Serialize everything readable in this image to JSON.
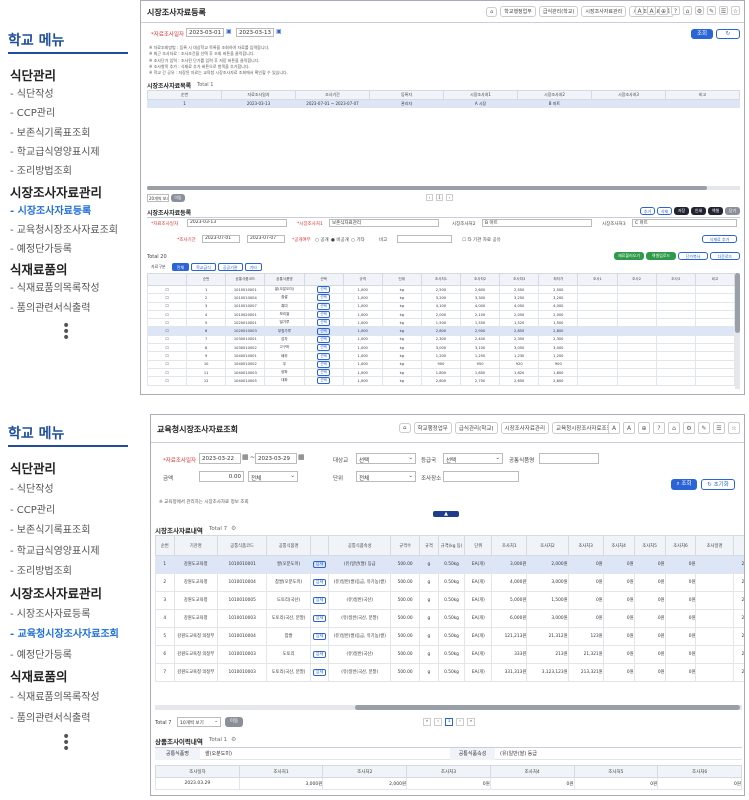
{
  "sidebar": {
    "title": "학교 메뉴",
    "groups": [
      {
        "label": "식단관리",
        "items": [
          "식단작성",
          "CCP관리",
          "보존식기록표조회",
          "학교급식영양표시제",
          "조리방법조회"
        ]
      },
      {
        "label": "시장조사자료관리",
        "items": [
          "시장조사자료등록",
          "교육청시장조사자료조회",
          "예정단가등록"
        ]
      },
      {
        "label": "식재료품의",
        "items": [
          "식재료품의목록작성",
          "품의관련서식출력"
        ]
      }
    ]
  },
  "screen1": {
    "active_menu": "시장조사자료등록",
    "title": "시장조사자료등록",
    "breadcrumb": [
      "학교행정업무",
      "급식관리(학교)",
      "시장조사자료관리",
      "시장조사자료등록"
    ],
    "period_label": "*자료조사일자",
    "date_from": "2023-03-01",
    "date_to": "2023-03-13",
    "search_button": "조회",
    "notes": [
      "※ 자료조회방법 : 등록 시 대상학교 목록을 조회하여 자료를 입력합니다.",
      "※ 최근 조사자료 : 조사조건을 선택 후 조회 버튼을 클릭합니다.",
      "※ 조사단가 입력 : 조사된 단가를 입력 후 저장 버튼을 클릭합니다.",
      "※ 조사항목 추가 : 식재료 추가 버튼으로 항목을 추가합니다.",
      "※ 학교 간 공유 : 저장된 자료는 교육청 시장조사자료 조회에서 확인할 수 있습니다."
    ],
    "list_title": "시장조사자료목록",
    "list_total": "Total 1",
    "list_headers": [
      "순번",
      "자료조사일자",
      "조사기간",
      "등록자",
      "시장조사처1",
      "시장조사처2",
      "시장조사처3",
      "비고"
    ],
    "list_rows": [
      [
        "1",
        "2023-03-13",
        "2023-07-01 ~ 2023-07-07",
        "관리자",
        "A 시장",
        "B 마트",
        "",
        ""
      ]
    ],
    "page_size": "20개씩 보기",
    "page_button": "이동",
    "reg_title": "시장조사자료등록",
    "reg_buttons": [
      "추가",
      "삭제",
      "저장",
      "인쇄",
      "엑셀",
      "닫기"
    ],
    "reg_fields": {
      "date_label": "*자료조사일자",
      "date_value": "2023-03-13",
      "place1_label": "*시장조사처1",
      "place1_value": "보존식자료관리",
      "place2_label": "시장조사처2",
      "place2_value": "B 마트",
      "place3_label": "시장조사처3",
      "place3_value": "C 마트",
      "period_label": "*조사기간",
      "period_from": "2023-07-01",
      "period_to": "2023-07-07",
      "public_label": "*공개여부",
      "public_options": [
        "공개",
        "비공개",
        "기타"
      ],
      "remark_label": "비고",
      "share_label": "타 기관 자료 공유"
    },
    "add_button": "식재료 추가",
    "grid_total": "Total 20",
    "grid_buttons": [
      "재료불러오기",
      "엑셀업로드",
      "단가복사",
      "다운로드"
    ],
    "grid_tabs": [
      "자료구분",
      "전체",
      "학교급식",
      "공공기관",
      "기타"
    ],
    "grid_headers": [
      "",
      "순번",
      "공통식품코드",
      "공통식품명",
      "선택",
      "규격",
      "단위",
      "조사처1",
      "조사처2",
      "조사처3",
      "최저가",
      "조사1",
      "조사2",
      "조사3",
      "비고"
    ],
    "grid_rows": [
      [
        "1",
        "1010010001",
        "쌀(오분도미)",
        "1,000",
        "kg",
        "2,500",
        "2,600",
        "2,550",
        "2,500"
      ],
      [
        "2",
        "1010010004",
        "찹쌀",
        "1,000",
        "kg",
        "3,200",
        "3,300",
        "3,250",
        "3,200"
      ],
      [
        "3",
        "1010010007",
        "흑미",
        "1,000",
        "kg",
        "4,100",
        "4,000",
        "4,050",
        "4,000"
      ],
      [
        "4",
        "1010020001",
        "보리쌀",
        "1,000",
        "kg",
        "2,000",
        "2,100",
        "2,050",
        "2,000"
      ],
      [
        "5",
        "1020010001",
        "밀가루",
        "1,000",
        "kg",
        "1,500",
        "1,550",
        "1,520",
        "1,500"
      ],
      [
        "6",
        "1020010003",
        "부침가루",
        "1,000",
        "kg",
        "2,800",
        "2,900",
        "2,850",
        "2,800"
      ],
      [
        "7",
        "1030010001",
        "감자",
        "1,000",
        "kg",
        "2,300",
        "2,400",
        "2,350",
        "2,300"
      ],
      [
        "8",
        "1030010002",
        "고구마",
        "1,000",
        "kg",
        "3,000",
        "3,100",
        "3,050",
        "3,000"
      ],
      [
        "9",
        "1040010001",
        "배추",
        "1,000",
        "kg",
        "1,200",
        "1,250",
        "1,230",
        "1,200"
      ],
      [
        "10",
        "1040010002",
        "무",
        "1,000",
        "kg",
        "900",
        "950",
        "920",
        "900"
      ],
      [
        "11",
        "1040010003",
        "양파",
        "1,000",
        "kg",
        "1,800",
        "1,850",
        "1,820",
        "1,800"
      ],
      [
        "12",
        "1040010005",
        "대파",
        "1,000",
        "kg",
        "2,600",
        "2,700",
        "2,650",
        "2,600"
      ]
    ]
  },
  "screen2": {
    "active_menu": "교육청시장조사자료조회",
    "title": "교육청시장조사자료조회",
    "breadcrumb": [
      "학교행정업무",
      "급식관리(학교)",
      "시장조사자료관리",
      "교육청시장조사자료조회"
    ],
    "toolbar": [
      "A",
      "A",
      "⊕",
      "?",
      "⌂",
      "⚙",
      "✎",
      "☰",
      "☆"
    ],
    "filters": {
      "date_label": "*자료조사일자",
      "date_from": "2023-03-22",
      "date_to": "2023-03-29",
      "target_label": "대상교",
      "target_value": "선택",
      "inst_label": "등급국",
      "inst_value": "선택",
      "name_label": "공통식품명",
      "name_value": "",
      "price_label": "금액",
      "price_value": "0.00",
      "price_cond": "전체",
      "unit_label": "단위",
      "unit_value": "전체",
      "place_label": "조사장소",
      "place_value": ""
    },
    "search_button": "조회",
    "reset_button": "초기화",
    "note": "※ 교육청에서 관리하는 시장조사자료 정보 조회",
    "list_title": "시장조사자료내역",
    "list_total": "Total 7",
    "headers": [
      "순번",
      "기관명",
      "공통식품코드",
      "공통식품명",
      "",
      "공통식품속성",
      "규격수",
      "규격",
      "규격(kg 등)",
      "단위",
      "조사처1",
      "조사처2",
      "조사처3",
      "조사처4",
      "조사처5",
      "조사처6",
      "조사일명",
      "조사일"
    ],
    "rows": [
      [
        "1",
        "강원도교육청",
        "1010010001",
        "쌀(오분도미)",
        "상세",
        "(유)일반(쌀) 등급",
        "500.00",
        "g",
        "0.50kg",
        "EA(개)",
        "3,000원",
        "2,000원",
        "0원",
        "0원",
        "0원",
        "0원",
        "",
        "2023.03.29"
      ],
      [
        "2",
        "강원도교육청",
        "1010010004",
        "찹쌀(오분도미)",
        "상세",
        "(유)일반(쌀)등급, 유기농(쌀)",
        "500.00",
        "g",
        "0.50kg",
        "EA(개)",
        "4,000원",
        "3,000원",
        "0원",
        "0원",
        "0원",
        "0원",
        "",
        "2023.03.28"
      ],
      [
        "3",
        "강원도교육청",
        "1010010005",
        "도토리(국산)",
        "상세",
        "(유)일반(국산)",
        "500.00",
        "g",
        "0.50kg",
        "EA(개)",
        "5,000원",
        "1,500원",
        "0원",
        "0원",
        "0원",
        "0원",
        "",
        "2023.03.28"
      ],
      [
        "4",
        "강원도교육청",
        "1010010003",
        "도토리(국산, 분말)",
        "상세",
        "(유)일반(국산, 분말)",
        "500.00",
        "g",
        "0.50kg",
        "EA(개)",
        "6,000원",
        "3,000원",
        "0원",
        "0원",
        "0원",
        "0원",
        "",
        "2023.03.27"
      ],
      [
        "5",
        "강원도교육청 의정부",
        "1010010004",
        "찹쌀",
        "상세",
        "(유)일반(쌀)등급, 유기농(쌀)",
        "500.00",
        "g",
        "0.50kg",
        "EA(개)",
        "121,213원",
        "21,312원",
        "123원",
        "0원",
        "0원",
        "0원",
        "",
        "2023.03.27"
      ],
      [
        "6",
        "강원도교육청 의정부",
        "1010010003",
        "도토리",
        "상세",
        "(유)일반(국산)",
        "500.00",
        "g",
        "0.50kg",
        "EA(개)",
        "333원",
        "213원",
        "21,321원",
        "0원",
        "0원",
        "0원",
        "",
        "2023.03.27"
      ],
      [
        "7",
        "강원도교육청 의정부",
        "1010010003",
        "도토리(국산, 분말)",
        "상세",
        "(유)일반(국산, 분말)",
        "500.00",
        "g",
        "0.50kg",
        "EA(개)",
        "331,313원",
        "3,123,123원",
        "213,321원",
        "0원",
        "0원",
        "0원",
        "",
        "2023.03.27"
      ]
    ],
    "footer_total": "Total 7",
    "page_size": "10개씩 보기",
    "page_button": "이동",
    "page_current": "1",
    "detail_title": "상품조사이력내역",
    "detail_total": "Total 1",
    "detail_name_label": "공통식품명",
    "detail_name_value": "쌀(오분도미)",
    "detail_attr_label": "공통식품속성",
    "detail_attr_value": "(유)일반(쌀) 등급",
    "detail_headers": [
      "조사일자",
      "조사처1",
      "조사처2",
      "조사처3",
      "조사처4",
      "조사처5",
      "조사처6"
    ],
    "detail_row": [
      "2023.03.29",
      "3,000원",
      "2,000원",
      "0원",
      "0원",
      "0원",
      "0원"
    ]
  },
  "colors": {
    "brand": "#1e4e9c",
    "accent": "#2a64d6",
    "highlight": "#dde6f7"
  }
}
